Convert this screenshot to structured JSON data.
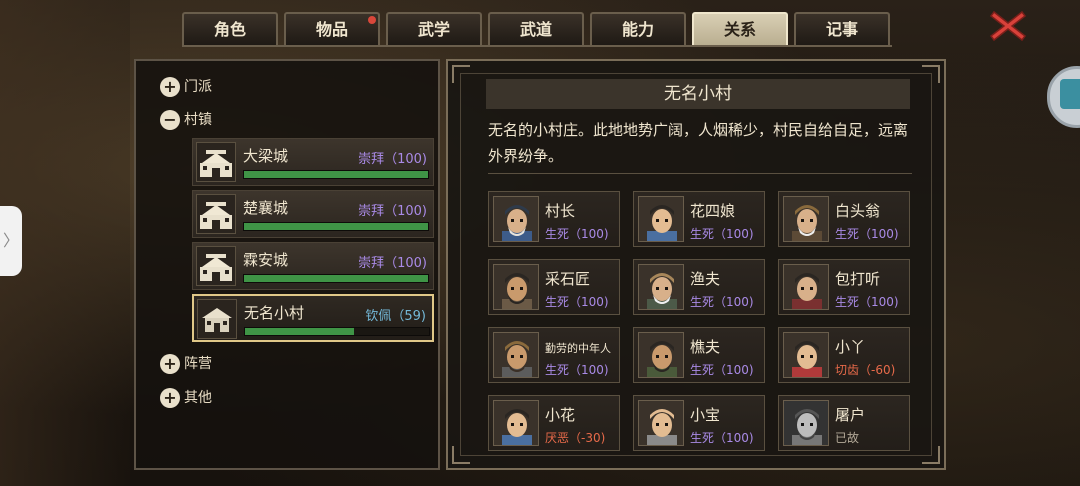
{
  "tabs": [
    {
      "label": "角色",
      "active": false,
      "badge": false
    },
    {
      "label": "物品",
      "active": false,
      "badge": true
    },
    {
      "label": "武学",
      "active": false,
      "badge": false
    },
    {
      "label": "武道",
      "active": false,
      "badge": false
    },
    {
      "label": "能力",
      "active": false,
      "badge": false
    },
    {
      "label": "关系",
      "active": true,
      "badge": false
    },
    {
      "label": "记事",
      "active": false,
      "badge": false
    }
  ],
  "close_icon": "close-x-icon",
  "side_handle_glyph": "〉",
  "tree": {
    "sect": {
      "label": "门派",
      "sign": "+"
    },
    "town": {
      "label": "村镇",
      "sign": "−"
    },
    "camp": {
      "label": "阵营",
      "sign": "+"
    },
    "other": {
      "label": "其他",
      "sign": "+"
    }
  },
  "towns": [
    {
      "name": "大梁城",
      "relation": "崇拜（100)",
      "level": 1.0,
      "color": "#a98ae6",
      "selected": false
    },
    {
      "name": "楚襄城",
      "relation": "崇拜（100)",
      "level": 1.0,
      "color": "#a98ae6",
      "selected": false
    },
    {
      "name": "霖安城",
      "relation": "崇拜（100)",
      "level": 1.0,
      "color": "#a98ae6",
      "selected": false
    },
    {
      "name": "无名小村",
      "relation": "钦佩（59)",
      "level": 0.59,
      "color": "#74b9d8",
      "selected": true
    }
  ],
  "detail": {
    "title": "无名小村",
    "description": "无名的小村庄。此地地势广阔，人烟稀少，村民自给自足，远离外界纷争。"
  },
  "npcs": [
    {
      "name": "村长",
      "status": "生死（100)",
      "tone": "purple",
      "small": false,
      "hat": "#2e3a4a",
      "skin": "#d8b08a",
      "beard": "#e8e4dc",
      "cloth": "#3d5c8a"
    },
    {
      "name": "花四娘",
      "status": "生死（100)",
      "tone": "purple",
      "small": false,
      "hat": "#2a2622",
      "skin": "#e3bc92",
      "beard": "",
      "cloth": "#4a6fa0"
    },
    {
      "name": "白头翁",
      "status": "生死（100)",
      "tone": "purple",
      "small": false,
      "hat": "#8a6a3c",
      "skin": "#d8b08a",
      "beard": "#eeeeee",
      "cloth": "#5c4a36"
    },
    {
      "name": "采石匠",
      "status": "生死（100)",
      "tone": "purple",
      "small": false,
      "hat": "#2a2622",
      "skin": "#c99a6c",
      "beard": "#2a2622",
      "cloth": "#6b5a46"
    },
    {
      "name": "渔夫",
      "status": "生死（100)",
      "tone": "purple",
      "small": false,
      "hat": "#a8875a",
      "skin": "#d8b08a",
      "beard": "#f0f0f0",
      "cloth": "#4c5a48"
    },
    {
      "name": "包打听",
      "status": "生死（100)",
      "tone": "purple",
      "small": false,
      "hat": "#2a2622",
      "skin": "#d8b08a",
      "beard": "",
      "cloth": "#7a3030"
    },
    {
      "name": "勤劳的中年人",
      "status": "生死（100)",
      "tone": "purple",
      "small": true,
      "hat": "#8a6a3c",
      "skin": "#c99a6c",
      "beard": "#3a2f26",
      "cloth": "#5c5c5c"
    },
    {
      "name": "樵夫",
      "status": "生死（100)",
      "tone": "purple",
      "small": false,
      "hat": "#2a2622",
      "skin": "#c99a6c",
      "beard": "#2a2622",
      "cloth": "#4a5a3a"
    },
    {
      "name": "小丫",
      "status": "切齿（-60)",
      "tone": "red",
      "small": false,
      "hat": "#2a2622",
      "skin": "#e3bc92",
      "beard": "",
      "cloth": "#b03a3a"
    },
    {
      "name": "小花",
      "status": "厌恶（-30)",
      "tone": "red",
      "small": false,
      "hat": "#2a2622",
      "skin": "#e3bc92",
      "beard": "",
      "cloth": "#4a6fa0"
    },
    {
      "name": "小宝",
      "status": "生死（100)",
      "tone": "purple",
      "small": false,
      "hat": "#e3bc92",
      "skin": "#e3bc92",
      "beard": "",
      "cloth": "#8a8a8a"
    },
    {
      "name": "屠户",
      "status": "已故",
      "tone": "gray",
      "small": false,
      "hat": "#555555",
      "skin": "#bdbdbd",
      "beard": "#444444",
      "cloth": "#777777",
      "grayscale": true
    }
  ]
}
